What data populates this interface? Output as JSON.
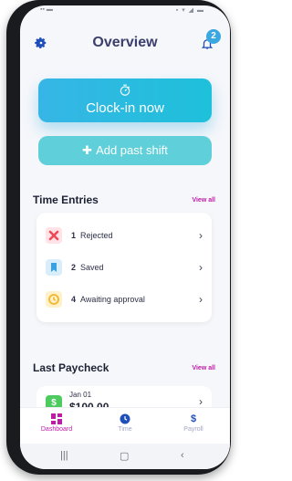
{
  "header": {
    "title": "Overview",
    "notification_count": "2"
  },
  "actions": {
    "clock_in_label": "Clock-in now",
    "add_past_shift_label": "Add past shift"
  },
  "time_entries": {
    "title": "Time Entries",
    "view_all": "View all",
    "items": [
      {
        "count": "1",
        "label": "Rejected",
        "color": "#ef4a5a",
        "bg": "#ffe3e6"
      },
      {
        "count": "2",
        "label": "Saved",
        "color": "#3aa0e0",
        "bg": "#d9eefb"
      },
      {
        "count": "4",
        "label": "Awaiting approval",
        "color": "#f3b62c",
        "bg": "#fff1c9"
      }
    ]
  },
  "last_paycheck": {
    "title": "Last Paycheck",
    "view_all": "View all",
    "date": "Jan 01",
    "amount": "$100.00",
    "icon_symbol": "$"
  },
  "tabs": [
    {
      "label": "Dashboard",
      "active": true,
      "icon": "dashboard-icon"
    },
    {
      "label": "Time",
      "active": false,
      "icon": "clock-icon"
    },
    {
      "label": "Payroll",
      "active": false,
      "icon": "dollar-icon"
    }
  ],
  "colors": {
    "accent": "#c01ba8",
    "primary": "#36b6e6",
    "secondary": "#5fcfd9",
    "title": "#3a3f6b"
  }
}
